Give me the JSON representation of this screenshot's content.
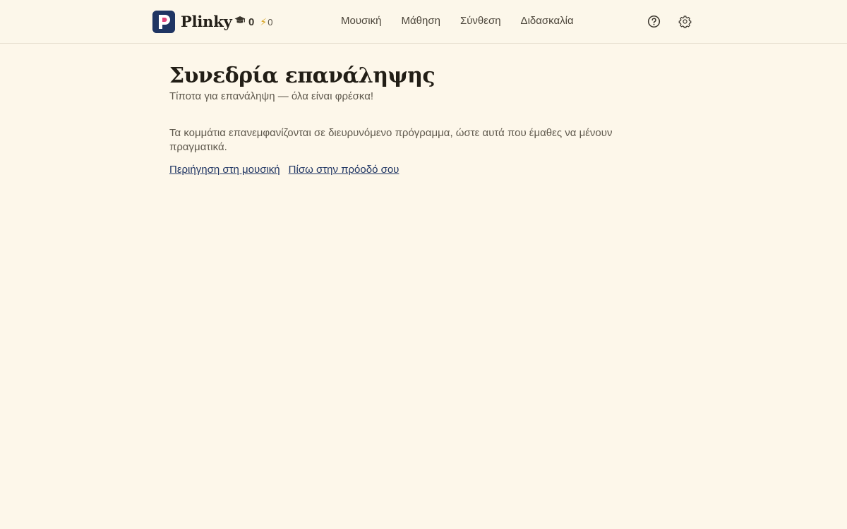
{
  "app": {
    "name": "Plinky",
    "xp": "0",
    "streak": "0"
  },
  "nav": {
    "items": [
      {
        "label": "Μουσική"
      },
      {
        "label": "Μάθηση"
      },
      {
        "label": "Σύνθεση"
      },
      {
        "label": "Διδασκαλία"
      }
    ]
  },
  "icons": {
    "help": "help-circle-icon",
    "settings": "gear-icon",
    "xp": "graduation-cap-icon",
    "streak": "lightning-icon"
  },
  "page": {
    "title": "Συνεδρία επανάληψης",
    "subtitle": "Τίποτα για επανάληψη — όλα είναι φρέσκα!",
    "description": "Τα κομμάτια επανεμφανίζονται σε διευρυνόμενο πρόγραμμα, ώστε αυτά που έμαθες να μένουν πραγματικά.",
    "links": {
      "browse": "Περιήγηση στη μουσική",
      "back": "Πίσω στην πρόοδό σου"
    }
  },
  "colors": {
    "background": "#fdf7ea",
    "brand": "#1f3563",
    "brand_accent": "#e0457b",
    "link": "#1f3563"
  }
}
